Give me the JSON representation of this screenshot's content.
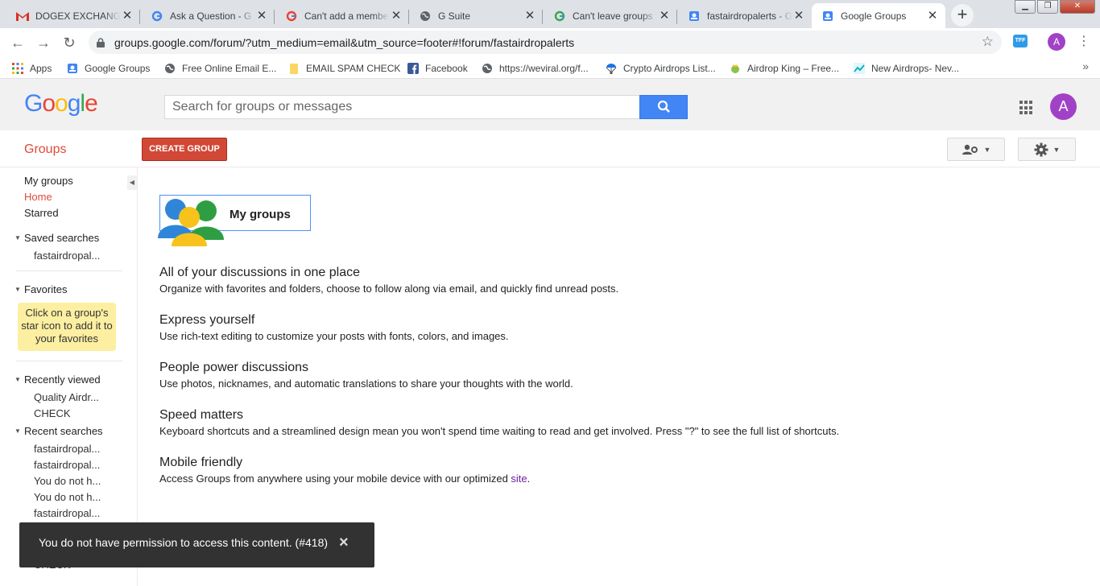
{
  "browser": {
    "tabs": [
      {
        "title": "DOGEX EXCHANGE",
        "favicon": "gmail-icon"
      },
      {
        "title": "Ask a Question - G",
        "favicon": "google-icon"
      },
      {
        "title": "Can't add a membe",
        "favicon": "google-icon"
      },
      {
        "title": "G Suite",
        "favicon": "globe-icon"
      },
      {
        "title": "Can't leave groups",
        "favicon": "google-icon"
      },
      {
        "title": "fastairdropalerts - G",
        "favicon": "google-groups-icon"
      },
      {
        "title": "Google Groups",
        "favicon": "google-groups-icon",
        "active": true
      }
    ],
    "url": "groups.google.com/forum/?utm_medium=email&utm_source=footer#!forum/fastairdropalerts",
    "extension_label": "TFF",
    "profile_initial": "A",
    "bookmarks": [
      {
        "label": "Apps",
        "icon": "apps-icon"
      },
      {
        "label": "Google Groups",
        "icon": "google-groups-icon"
      },
      {
        "label": "Free Online Email E...",
        "icon": "globe-icon"
      },
      {
        "label": "EMAIL SPAM CHECK",
        "icon": "folder-icon"
      },
      {
        "label": "Facebook",
        "icon": "facebook-icon"
      },
      {
        "label": "https://weviral.org/f...",
        "icon": "globe-icon"
      },
      {
        "label": "Crypto Airdrops List...",
        "icon": "parachute-icon"
      },
      {
        "label": "Airdrop King – Free...",
        "icon": "king-icon"
      },
      {
        "label": "New Airdrops- Nev...",
        "icon": "chart-icon"
      }
    ]
  },
  "header": {
    "logo": "Google",
    "search_placeholder": "Search for groups or messages",
    "avatar_initial": "A"
  },
  "actionbar": {
    "title": "Groups",
    "create_label": "CREATE GROUP"
  },
  "sidebar": {
    "links": [
      "My groups",
      "Home",
      "Starred"
    ],
    "active_link": "Home",
    "saved_searches": {
      "title": "Saved searches",
      "items": [
        "fastairdropal..."
      ]
    },
    "favorites": {
      "title": "Favorites",
      "hint": "Click on a group's star icon to add it to your favorites"
    },
    "recently_viewed": {
      "title": "Recently viewed",
      "items": [
        "Quality Airdr...",
        "CHECK"
      ]
    },
    "recent_searches": {
      "title": "Recent searches",
      "items": [
        "fastairdropal...",
        "fastairdropal...",
        "You do not h...",
        "You do not h...",
        "fastairdropal..."
      ]
    },
    "obscured_item": "CHECK"
  },
  "main": {
    "card_label": "My groups",
    "features": [
      {
        "title": "All of your discussions in one place",
        "desc": "Organize with favorites and folders, choose to follow along via email, and quickly find unread posts."
      },
      {
        "title": "Express yourself",
        "desc": "Use rich-text editing to customize your posts with fonts, colors, and images."
      },
      {
        "title": "People power discussions",
        "desc": "Use photos, nicknames, and automatic translations to share your thoughts with the world."
      },
      {
        "title": "Speed matters",
        "desc": "Keyboard shortcuts and a streamlined design mean you won't spend time waiting to read and get involved. Press \"?\" to see the full list of shortcuts."
      },
      {
        "title": "Mobile friendly",
        "desc": "Access Groups from anywhere using your mobile device with our optimized ",
        "link": "site",
        "after": "."
      }
    ]
  },
  "toast": {
    "message": "You do not have permission to access this content. (#418)"
  },
  "colors": {
    "accent_red": "#dd4b39",
    "button_red": "#d14836",
    "search_blue": "#4285f4",
    "avatar_purple": "#a142c6"
  }
}
